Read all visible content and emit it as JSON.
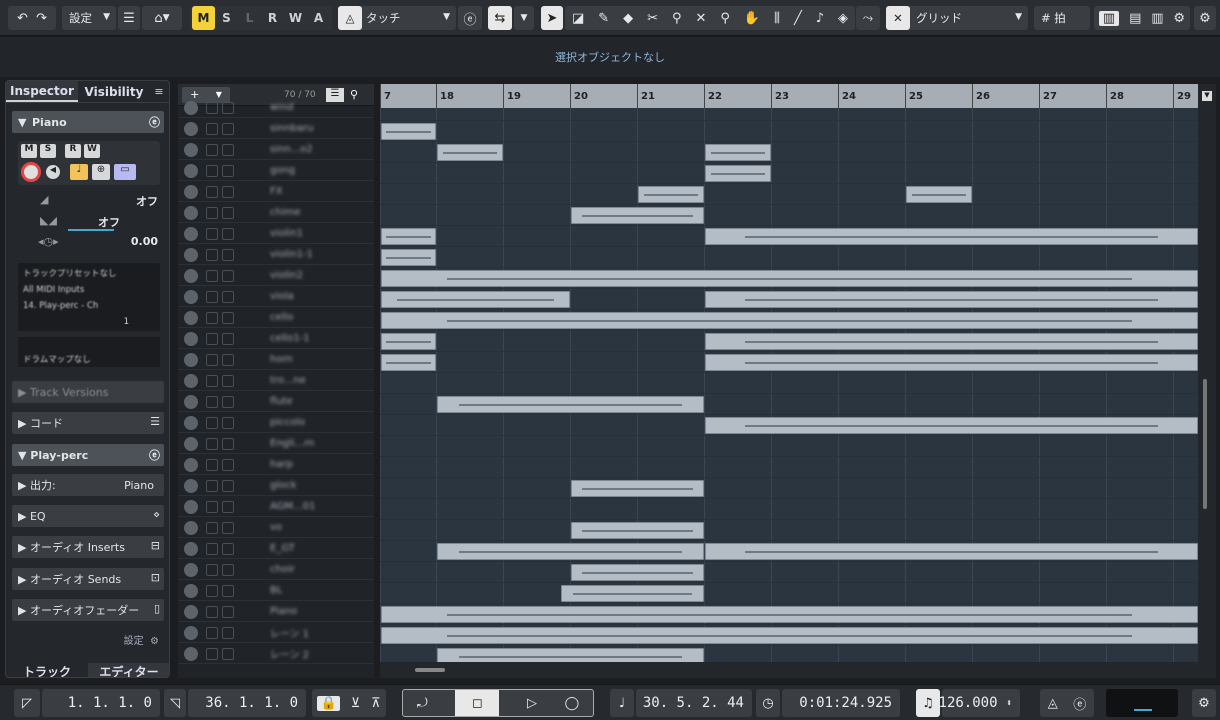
{
  "toolbar": {
    "setup_label": "設定",
    "msb": [
      "M",
      "S",
      "L",
      "R",
      "W",
      "A"
    ],
    "touch_label": "タッチ",
    "grid_label": "グリッド",
    "snap_label": "拍"
  },
  "info_line": "選択オブジェクトなし",
  "inspector": {
    "tabs": [
      "Inspector",
      "Visibility"
    ],
    "track_name": "Piano",
    "mini_btns": [
      "M",
      "S",
      "R",
      "W"
    ],
    "vol_value": "オフ",
    "pan_value": "オフ",
    "delay_value": "0.00",
    "midi_in": [
      "トラックプリセットなし",
      "All MIDI Inputs",
      "14. Play-perc - Ch"
    ],
    "channel": "1",
    "drum_map": "ドラムマップなし",
    "sections": [
      "Track Versions",
      "コード",
      "Play-perc",
      "出力:",
      "EQ",
      "オーディオ Inserts",
      "オーディオ Sends",
      "オーディオフェーダー"
    ],
    "output_value": "Piano",
    "setup_label": "設定",
    "bottom_tabs": [
      "トラック",
      "エディター"
    ]
  },
  "tracklist": {
    "count": "70 / 70",
    "tracks": [
      "wind",
      "sinnbaru",
      "sinn...o2",
      "gong",
      "FX",
      "chime",
      "violin1",
      "violin1-1",
      "violin2",
      "viola",
      "cello",
      "cello1-1",
      "horn",
      "tro...ne",
      "flute",
      "piccolo",
      "Engli...rn",
      "harp",
      "glock",
      "AGM...01",
      "vo",
      "E_GT",
      "choir",
      "BL",
      "Piano",
      "レーン 1",
      "レーン 2"
    ]
  },
  "ruler": {
    "bars": [
      "7",
      "18",
      "19",
      "20",
      "21",
      "22",
      "23",
      "24",
      "25",
      "26",
      "27",
      "28",
      "29"
    ]
  },
  "transport": {
    "left_locator": "1. 1. 1.   0",
    "right_locator": "36. 1. 1.   0",
    "position_bars": "30. 5. 2. 44",
    "position_time": "0:01:24.925",
    "tempo": "126.000"
  },
  "colors": {
    "accent": "#f2d13b",
    "lane_bg": "#2b3540",
    "part": "#b4bcc5"
  }
}
